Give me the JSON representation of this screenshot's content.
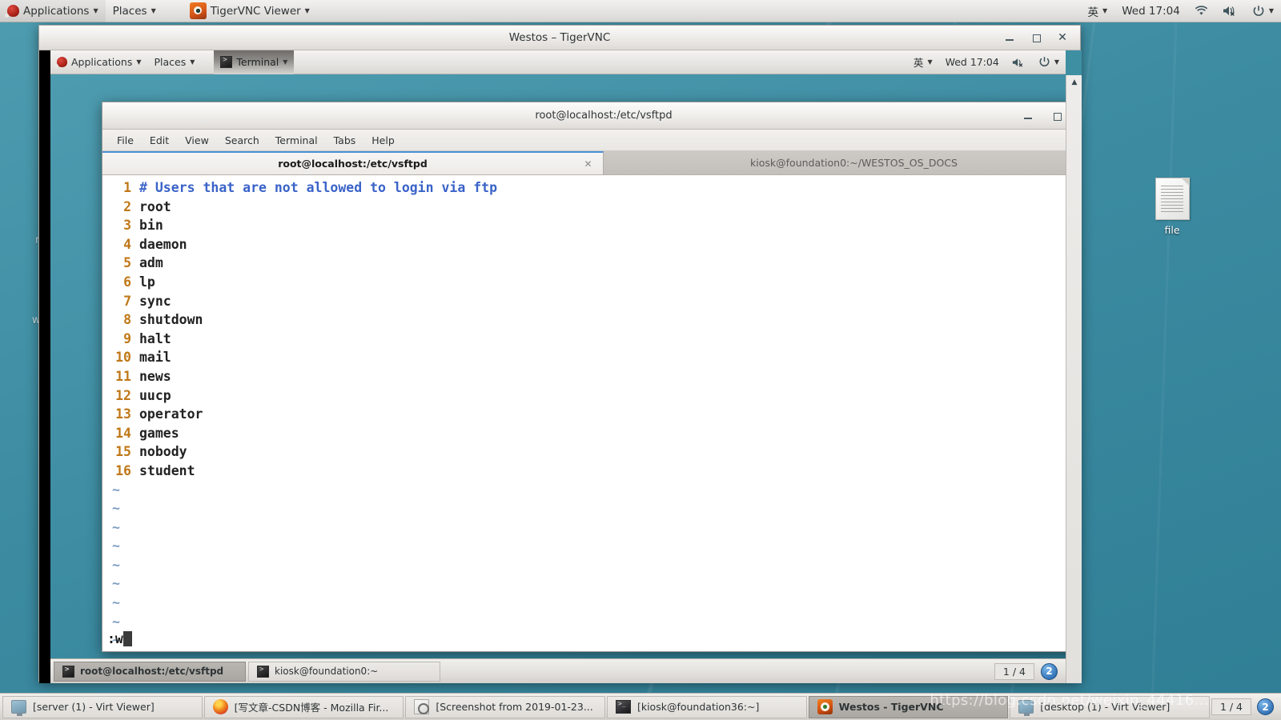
{
  "host": {
    "top_panel": {
      "applications": "Applications",
      "places": "Places",
      "active_app": "TigerVNC Viewer",
      "input_method": "英",
      "clock": "Wed 17:04",
      "icons": [
        "gnome-foot-icon",
        "tigervnc-icon",
        "wifi-icon",
        "volume-muted-icon",
        "power-icon",
        "chevron-down-icon"
      ]
    },
    "desktop": {
      "file_icon_label": "file",
      "ghost_text_1": "r",
      "ghost_text_2": "w"
    },
    "taskbar": {
      "items": [
        {
          "label": "[server (1) - Virt Viewer]",
          "icon": "monitor-icon",
          "active": false
        },
        {
          "label": "[写文章-CSDN博客 - Mozilla Fir...",
          "icon": "firefox-icon",
          "active": false
        },
        {
          "label": "[Screenshot from 2019-01-23...",
          "icon": "screenshot-icon",
          "active": false
        },
        {
          "label": "[kiosk@foundation36:~]",
          "icon": "terminal-icon",
          "active": false
        },
        {
          "label": "Westos - TigerVNC",
          "icon": "tigervnc-icon",
          "active": true
        },
        {
          "label": "[desktop (1) - Virt Viewer]",
          "icon": "monitor-icon",
          "active": false
        }
      ],
      "workspace_count": "1 / 4",
      "workspace_badge": "2"
    },
    "watermark": "https://blog.csdn.net/weixin_44416..."
  },
  "vnc_window": {
    "title": "Westos – TigerVNC",
    "buttons": {
      "minimize": "–",
      "maximize": "□",
      "close": "✕"
    },
    "scroll": {
      "up_arrow": "▲",
      "down_arrow": "▼"
    }
  },
  "guest": {
    "top_panel": {
      "applications": "Applications",
      "places": "Places",
      "active_window": "Terminal",
      "input_method": "英",
      "clock": "Wed 17:04"
    },
    "bottom_panel": {
      "tasks": [
        {
          "label": "root@localhost:/etc/vsftpd",
          "active": true
        },
        {
          "label": "kiosk@foundation0:~",
          "active": false
        }
      ],
      "workspace_count": "1 / 4",
      "workspace_badge": "2"
    }
  },
  "terminal": {
    "title": "root@localhost:/etc/vsftpd",
    "window_buttons": {
      "minimize": "–",
      "maximize": "□",
      "close": "✕"
    },
    "menu": [
      "File",
      "Edit",
      "View",
      "Search",
      "Terminal",
      "Tabs",
      "Help"
    ],
    "tabs": [
      {
        "label": "root@localhost:/etc/vsftpd",
        "close": "✕",
        "active": true
      },
      {
        "label": "kiosk@foundation0:~/WESTOS_OS_DOCS",
        "close": "✕",
        "active": false
      }
    ],
    "editor": {
      "lines": [
        {
          "n": "1",
          "text": "# Users that are not allowed to login via ftp",
          "comment": true
        },
        {
          "n": "2",
          "text": "root",
          "comment": false
        },
        {
          "n": "3",
          "text": "bin",
          "comment": false
        },
        {
          "n": "4",
          "text": "daemon",
          "comment": false
        },
        {
          "n": "5",
          "text": "adm",
          "comment": false
        },
        {
          "n": "6",
          "text": "lp",
          "comment": false
        },
        {
          "n": "7",
          "text": "sync",
          "comment": false
        },
        {
          "n": "8",
          "text": "shutdown",
          "comment": false
        },
        {
          "n": "9",
          "text": "halt",
          "comment": false
        },
        {
          "n": "10",
          "text": "mail",
          "comment": false
        },
        {
          "n": "11",
          "text": "news",
          "comment": false
        },
        {
          "n": "12",
          "text": "uucp",
          "comment": false
        },
        {
          "n": "13",
          "text": "operator",
          "comment": false
        },
        {
          "n": "14",
          "text": "games",
          "comment": false
        },
        {
          "n": "15",
          "text": "nobody",
          "comment": false
        },
        {
          "n": "16",
          "text": "student",
          "comment": false
        }
      ],
      "empty_marker": "~",
      "empty_marker_count": 9,
      "command_line": ":w"
    }
  },
  "colors": {
    "desktop_teal": "#3f8fa3",
    "panel_grey": "#e4e2e0",
    "line_number": "#c07818",
    "comment_blue": "#3a63c8",
    "tilde_blue": "#7d9dc4",
    "tab_accent": "#4a90d9",
    "badge_blue": "#2b6cb0"
  }
}
